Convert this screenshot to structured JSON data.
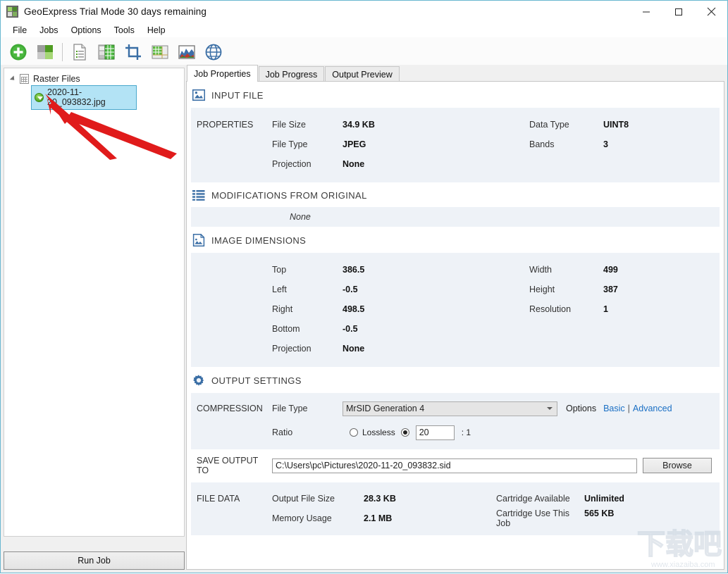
{
  "window": {
    "title": "GeoExpress Trial Mode 30 days remaining",
    "app_icon": "geoexpress-app-icon",
    "minimize": "minimize-icon",
    "maximize": "maximize-icon",
    "close": "close-icon"
  },
  "menubar": {
    "items": [
      {
        "label": "File"
      },
      {
        "label": "Jobs"
      },
      {
        "label": "Options"
      },
      {
        "label": "Tools"
      },
      {
        "label": "Help"
      }
    ]
  },
  "toolbar": {
    "buttons": [
      {
        "name": "add-image-icon"
      },
      {
        "name": "mosaic-icon"
      },
      {
        "name": "metadata-icon"
      },
      {
        "name": "tiles-icon"
      },
      {
        "name": "crop-icon"
      },
      {
        "name": "grid-overlay-icon"
      },
      {
        "name": "histogram-icon"
      },
      {
        "name": "globe-icon"
      }
    ]
  },
  "sidebar": {
    "root": {
      "label": "Raster Files"
    },
    "files": [
      {
        "label": "2020-11-20_093832.jpg",
        "selected": true
      }
    ],
    "run_job_label": "Run Job"
  },
  "tabs": [
    {
      "label": "Job Properties",
      "active": true
    },
    {
      "label": "Job Progress",
      "active": false
    },
    {
      "label": "Output Preview",
      "active": false
    }
  ],
  "input_file": {
    "heading": "INPUT FILE",
    "icon": "image-file-icon",
    "group_label": "PROPERTIES",
    "left": [
      {
        "key": "File Size",
        "value": "34.9 KB"
      },
      {
        "key": "File Type",
        "value": "JPEG"
      },
      {
        "key": "Projection",
        "value": "None"
      }
    ],
    "right": [
      {
        "key": "Data Type",
        "value": "UINT8"
      },
      {
        "key": "Bands",
        "value": "3"
      }
    ]
  },
  "modifications": {
    "heading": "MODIFICATIONS FROM ORIGINAL",
    "icon": "list-icon",
    "value": "None"
  },
  "image_dimensions": {
    "heading": "IMAGE DIMENSIONS",
    "icon": "image-dimensions-icon",
    "left": [
      {
        "key": "Top",
        "value": "386.5"
      },
      {
        "key": "Left",
        "value": "-0.5"
      },
      {
        "key": "Right",
        "value": "498.5"
      },
      {
        "key": "Bottom",
        "value": "-0.5"
      },
      {
        "key": "Projection",
        "value": "None"
      }
    ],
    "right": [
      {
        "key": "Width",
        "value": "499"
      },
      {
        "key": "Height",
        "value": "387"
      },
      {
        "key": "Resolution",
        "value": "1"
      }
    ]
  },
  "output_settings": {
    "heading": "OUTPUT SETTINGS",
    "icon": "gear-icon",
    "compression_label": "COMPRESSION",
    "file_type_label": "File Type",
    "file_type_value": "MrSID Generation 4",
    "file_type_options": [
      "MrSID Generation 4"
    ],
    "options_label": "Options",
    "options_basic": "Basic",
    "options_separator": "|",
    "options_advanced": "Advanced",
    "ratio_label": "Ratio",
    "lossless_label": "Lossless",
    "lossless_selected": false,
    "ratio_selected": true,
    "ratio_value": "20",
    "ratio_suffix": ": 1",
    "save_output_label": "SAVE OUTPUT TO",
    "save_output_path": "C:\\Users\\pc\\Pictures\\2020-11-20_093832.sid",
    "browse_label": "Browse"
  },
  "file_data": {
    "group_label": "FILE DATA",
    "left": [
      {
        "key": "Output File Size",
        "value": "28.3 KB"
      },
      {
        "key": "Memory Usage",
        "value": "2.1 MB"
      }
    ],
    "right": [
      {
        "key": "Cartridge Available",
        "value": "Unlimited"
      },
      {
        "key": "Cartridge Use This Job",
        "value": "565 KB"
      }
    ]
  },
  "watermark": {
    "text": "下载吧",
    "url": "www.xiazaiba.com"
  },
  "colors": {
    "accent_blue": "#1a6fc4",
    "selection": "#b3e3f5",
    "section_bg": "#eef2f7",
    "annotation_arrow": "#e01b1b",
    "green": "#4ea31f"
  }
}
